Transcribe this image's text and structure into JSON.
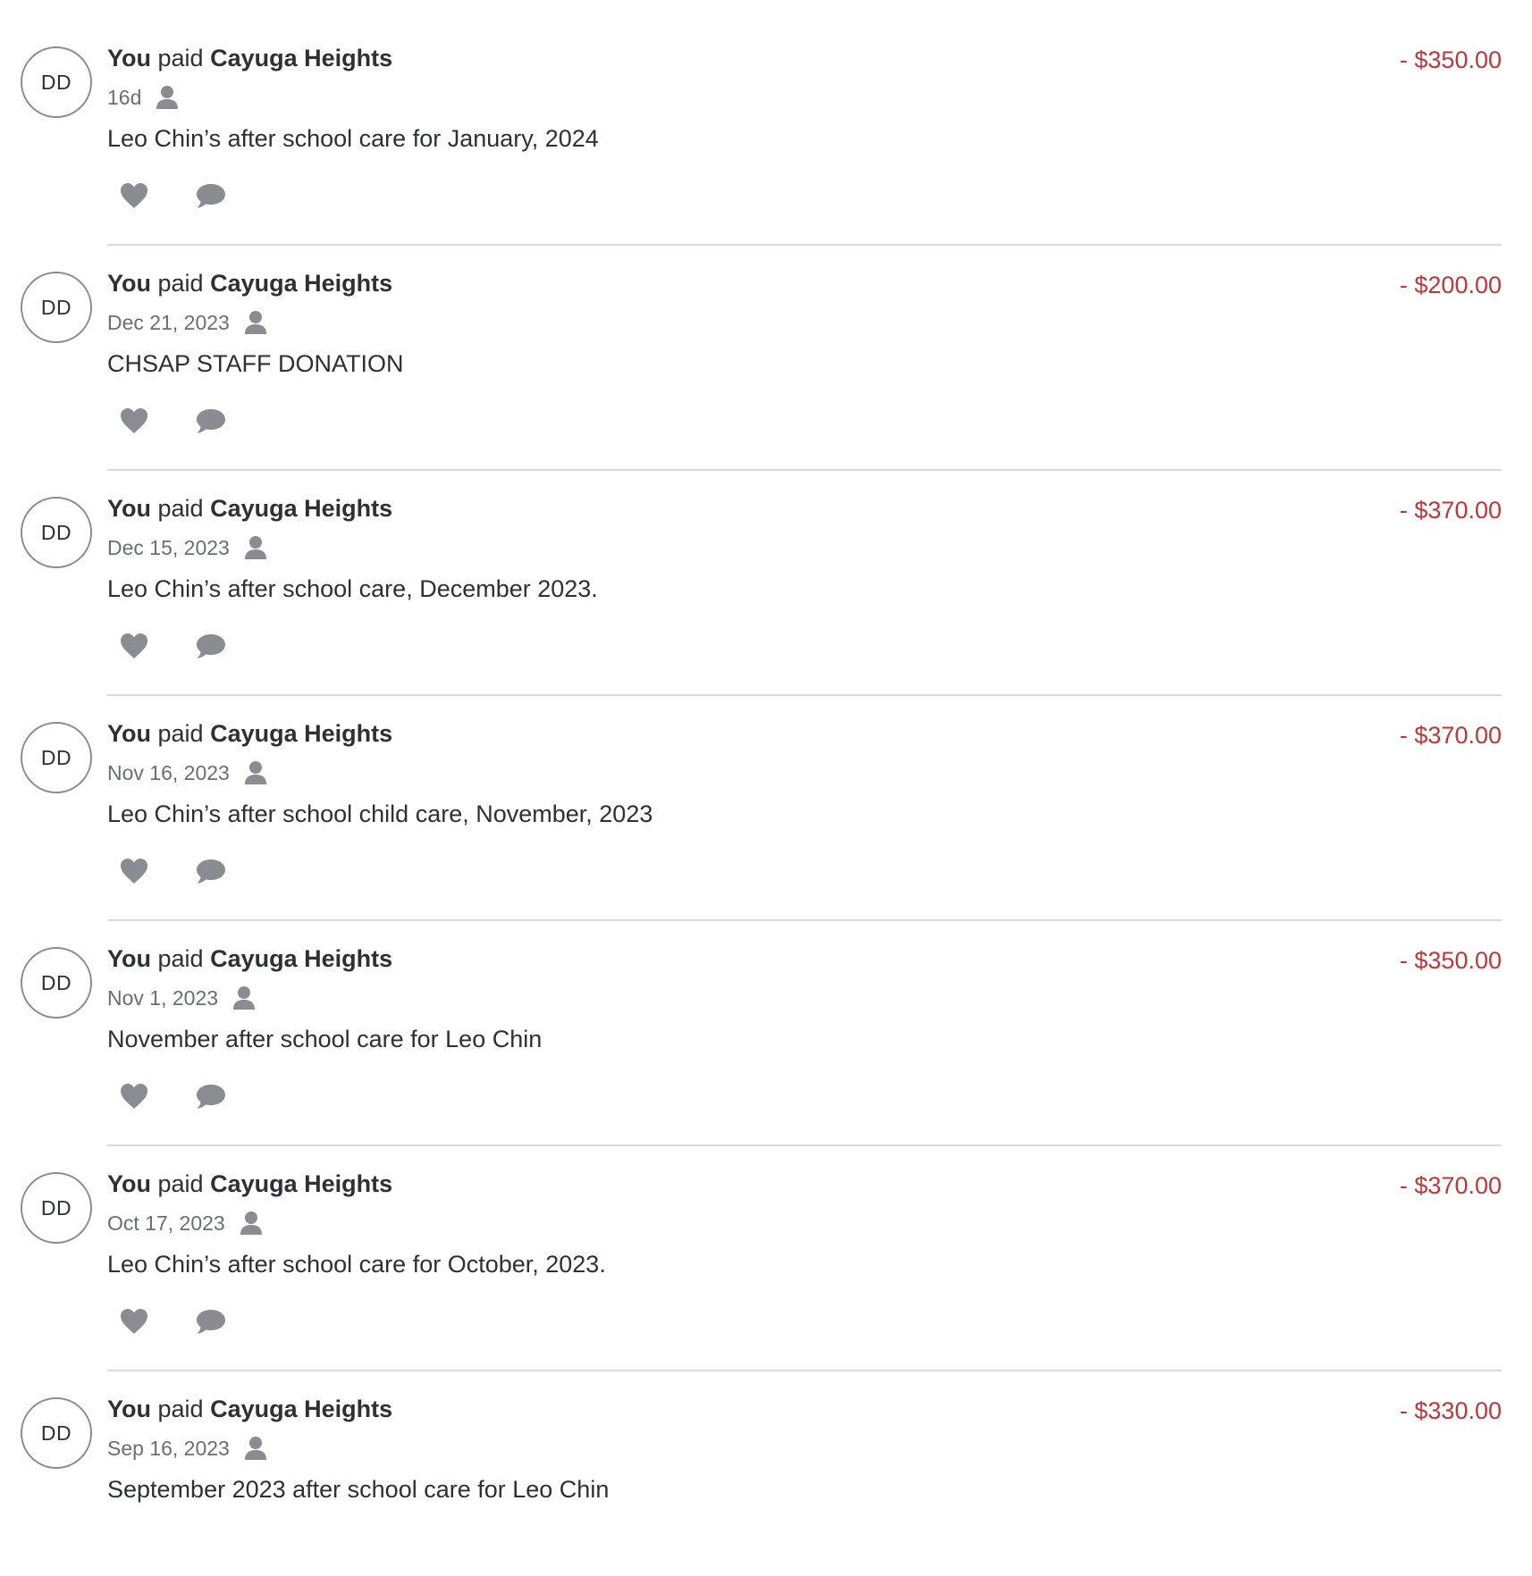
{
  "feed": {
    "transactions": [
      {
        "avatar": "DD",
        "actor": "You",
        "verb": "paid",
        "payee": "Cayuga Heights",
        "date": "16d",
        "audience_icon": "person-icon",
        "description": "Leo Chin’s after school care for January, 2024",
        "amount": "- $350.00"
      },
      {
        "avatar": "DD",
        "actor": "You",
        "verb": "paid",
        "payee": "Cayuga Heights",
        "date": "Dec 21, 2023",
        "audience_icon": "person-icon",
        "description": "CHSAP STAFF DONATION",
        "amount": "- $200.00"
      },
      {
        "avatar": "DD",
        "actor": "You",
        "verb": "paid",
        "payee": "Cayuga Heights",
        "date": "Dec 15, 2023",
        "audience_icon": "person-icon",
        "description": "Leo Chin’s after school care, December 2023.",
        "amount": "- $370.00"
      },
      {
        "avatar": "DD",
        "actor": "You",
        "verb": "paid",
        "payee": "Cayuga Heights",
        "date": "Nov 16, 2023",
        "audience_icon": "person-icon",
        "description": "Leo Chin’s after school child care, November, 2023",
        "amount": "- $370.00"
      },
      {
        "avatar": "DD",
        "actor": "You",
        "verb": "paid",
        "payee": "Cayuga Heights",
        "date": "Nov 1, 2023",
        "audience_icon": "person-icon",
        "description": "November after school care for Leo Chin",
        "amount": "- $350.00"
      },
      {
        "avatar": "DD",
        "actor": "You",
        "verb": "paid",
        "payee": "Cayuga Heights",
        "date": "Oct 17, 2023",
        "audience_icon": "person-icon",
        "description": "Leo Chin’s after school care for October, 2023.",
        "amount": "- $370.00"
      },
      {
        "avatar": "DD",
        "actor": "You",
        "verb": "paid",
        "payee": "Cayuga Heights",
        "date": "Sep 16, 2023",
        "audience_icon": "person-icon",
        "description": "September 2023 after school care for Leo Chin",
        "amount": "- $330.00"
      }
    ],
    "action_icons": [
      "heart-icon",
      "comment-icon"
    ]
  },
  "colors": {
    "amount_debit": "#c0373a",
    "text_primary": "#2f3033",
    "text_secondary": "#6b6e73",
    "icon_gray": "#8a8c92",
    "divider": "#d9dadc",
    "avatar_border": "#8a8c90"
  }
}
